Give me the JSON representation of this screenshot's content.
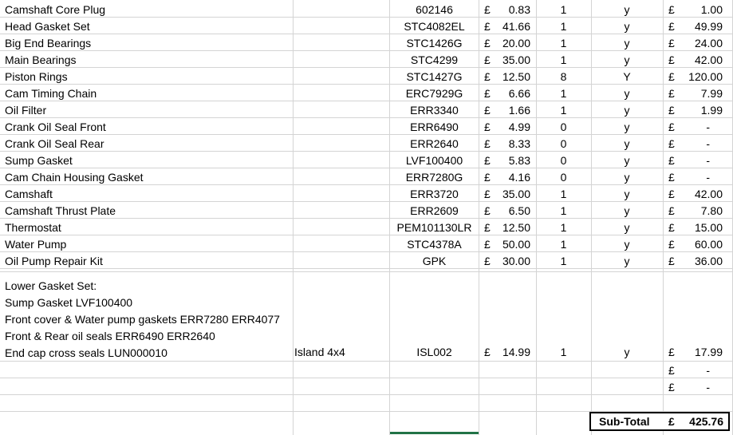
{
  "rows": [
    {
      "desc": "Camshaft Core Plug",
      "supplier": "",
      "part": "602146",
      "curr": "£",
      "price": "0.83",
      "qty": "1",
      "flag": "y",
      "tcurr": "£",
      "total": "1.00"
    },
    {
      "desc": "Head Gasket Set",
      "supplier": "",
      "part": "STC4082EL",
      "curr": "£",
      "price": "41.66",
      "qty": "1",
      "flag": "y",
      "tcurr": "£",
      "total": "49.99"
    },
    {
      "desc": "Big End Bearings",
      "supplier": "",
      "part": "STC1426G",
      "curr": "£",
      "price": "20.00",
      "qty": "1",
      "flag": "y",
      "tcurr": "£",
      "total": "24.00"
    },
    {
      "desc": "Main Bearings",
      "supplier": "",
      "part": "STC4299",
      "curr": "£",
      "price": "35.00",
      "qty": "1",
      "flag": "y",
      "tcurr": "£",
      "total": "42.00"
    },
    {
      "desc": "Piston Rings",
      "supplier": "",
      "part": "STC1427G",
      "curr": "£",
      "price": "12.50",
      "qty": "8",
      "flag": "Y",
      "tcurr": "£",
      "total": "120.00"
    },
    {
      "desc": "Cam Timing Chain",
      "supplier": "",
      "part": "ERC7929G",
      "curr": "£",
      "price": "6.66",
      "qty": "1",
      "flag": "y",
      "tcurr": "£",
      "total": "7.99"
    },
    {
      "desc": "Oil Filter",
      "supplier": "",
      "part": "ERR3340",
      "curr": "£",
      "price": "1.66",
      "qty": "1",
      "flag": "y",
      "tcurr": "£",
      "total": "1.99"
    },
    {
      "desc": "Crank Oil Seal Front",
      "supplier": "",
      "part": "ERR6490",
      "curr": "£",
      "price": "4.99",
      "qty": "0",
      "flag": "y",
      "tcurr": "£",
      "total": "-"
    },
    {
      "desc": "Crank Oil Seal Rear",
      "supplier": "",
      "part": "ERR2640",
      "curr": "£",
      "price": "8.33",
      "qty": "0",
      "flag": "y",
      "tcurr": "£",
      "total": "-"
    },
    {
      "desc": "Sump Gasket",
      "supplier": "",
      "part": "LVF100400",
      "curr": "£",
      "price": "5.83",
      "qty": "0",
      "flag": "y",
      "tcurr": "£",
      "total": "-"
    },
    {
      "desc": "Cam Chain Housing Gasket",
      "supplier": "",
      "part": "ERR7280G",
      "curr": "£",
      "price": "4.16",
      "qty": "0",
      "flag": "y",
      "tcurr": "£",
      "total": "-"
    },
    {
      "desc": "Camshaft",
      "supplier": "",
      "part": "ERR3720",
      "curr": "£",
      "price": "35.00",
      "qty": "1",
      "flag": "y",
      "tcurr": "£",
      "total": "42.00"
    },
    {
      "desc": "Camshaft Thrust Plate",
      "supplier": "",
      "part": "ERR2609",
      "curr": "£",
      "price": "6.50",
      "qty": "1",
      "flag": "y",
      "tcurr": "£",
      "total": "7.80"
    },
    {
      "desc": "Thermostat",
      "supplier": "",
      "part": "PEM101130LR",
      "curr": "£",
      "price": "12.50",
      "qty": "1",
      "flag": "y",
      "tcurr": "£",
      "total": "15.00"
    },
    {
      "desc": "Water Pump",
      "supplier": "",
      "part": "STC4378A",
      "curr": "£",
      "price": "50.00",
      "qty": "1",
      "flag": "y",
      "tcurr": "£",
      "total": "60.00"
    },
    {
      "desc": "Oil Pump Repair Kit",
      "supplier": "",
      "part": "GPK",
      "curr": "£",
      "price": "30.00",
      "qty": "1",
      "flag": "y",
      "tcurr": "£",
      "total": "36.00"
    }
  ],
  "gasket_row": {
    "desc": "Lower Gasket Set:\nSump Gasket LVF100400\nFront cover & Water pump gaskets ERR7280 ERR4077\nFront & Rear oil seals ERR6490 ERR2640\nEnd cap cross seals LUN000010",
    "supplier": "Island 4x4",
    "part": "ISL002",
    "curr": "£",
    "price": "14.99",
    "qty": "1",
    "flag": "y",
    "tcurr": "£",
    "total": "17.99"
  },
  "empty_rows": [
    {
      "tcurr": "£",
      "total": "-"
    },
    {
      "tcurr": "£",
      "total": "-"
    }
  ],
  "subtotal": {
    "label": "Sub-Total",
    "curr": "£",
    "value": "425.76"
  }
}
